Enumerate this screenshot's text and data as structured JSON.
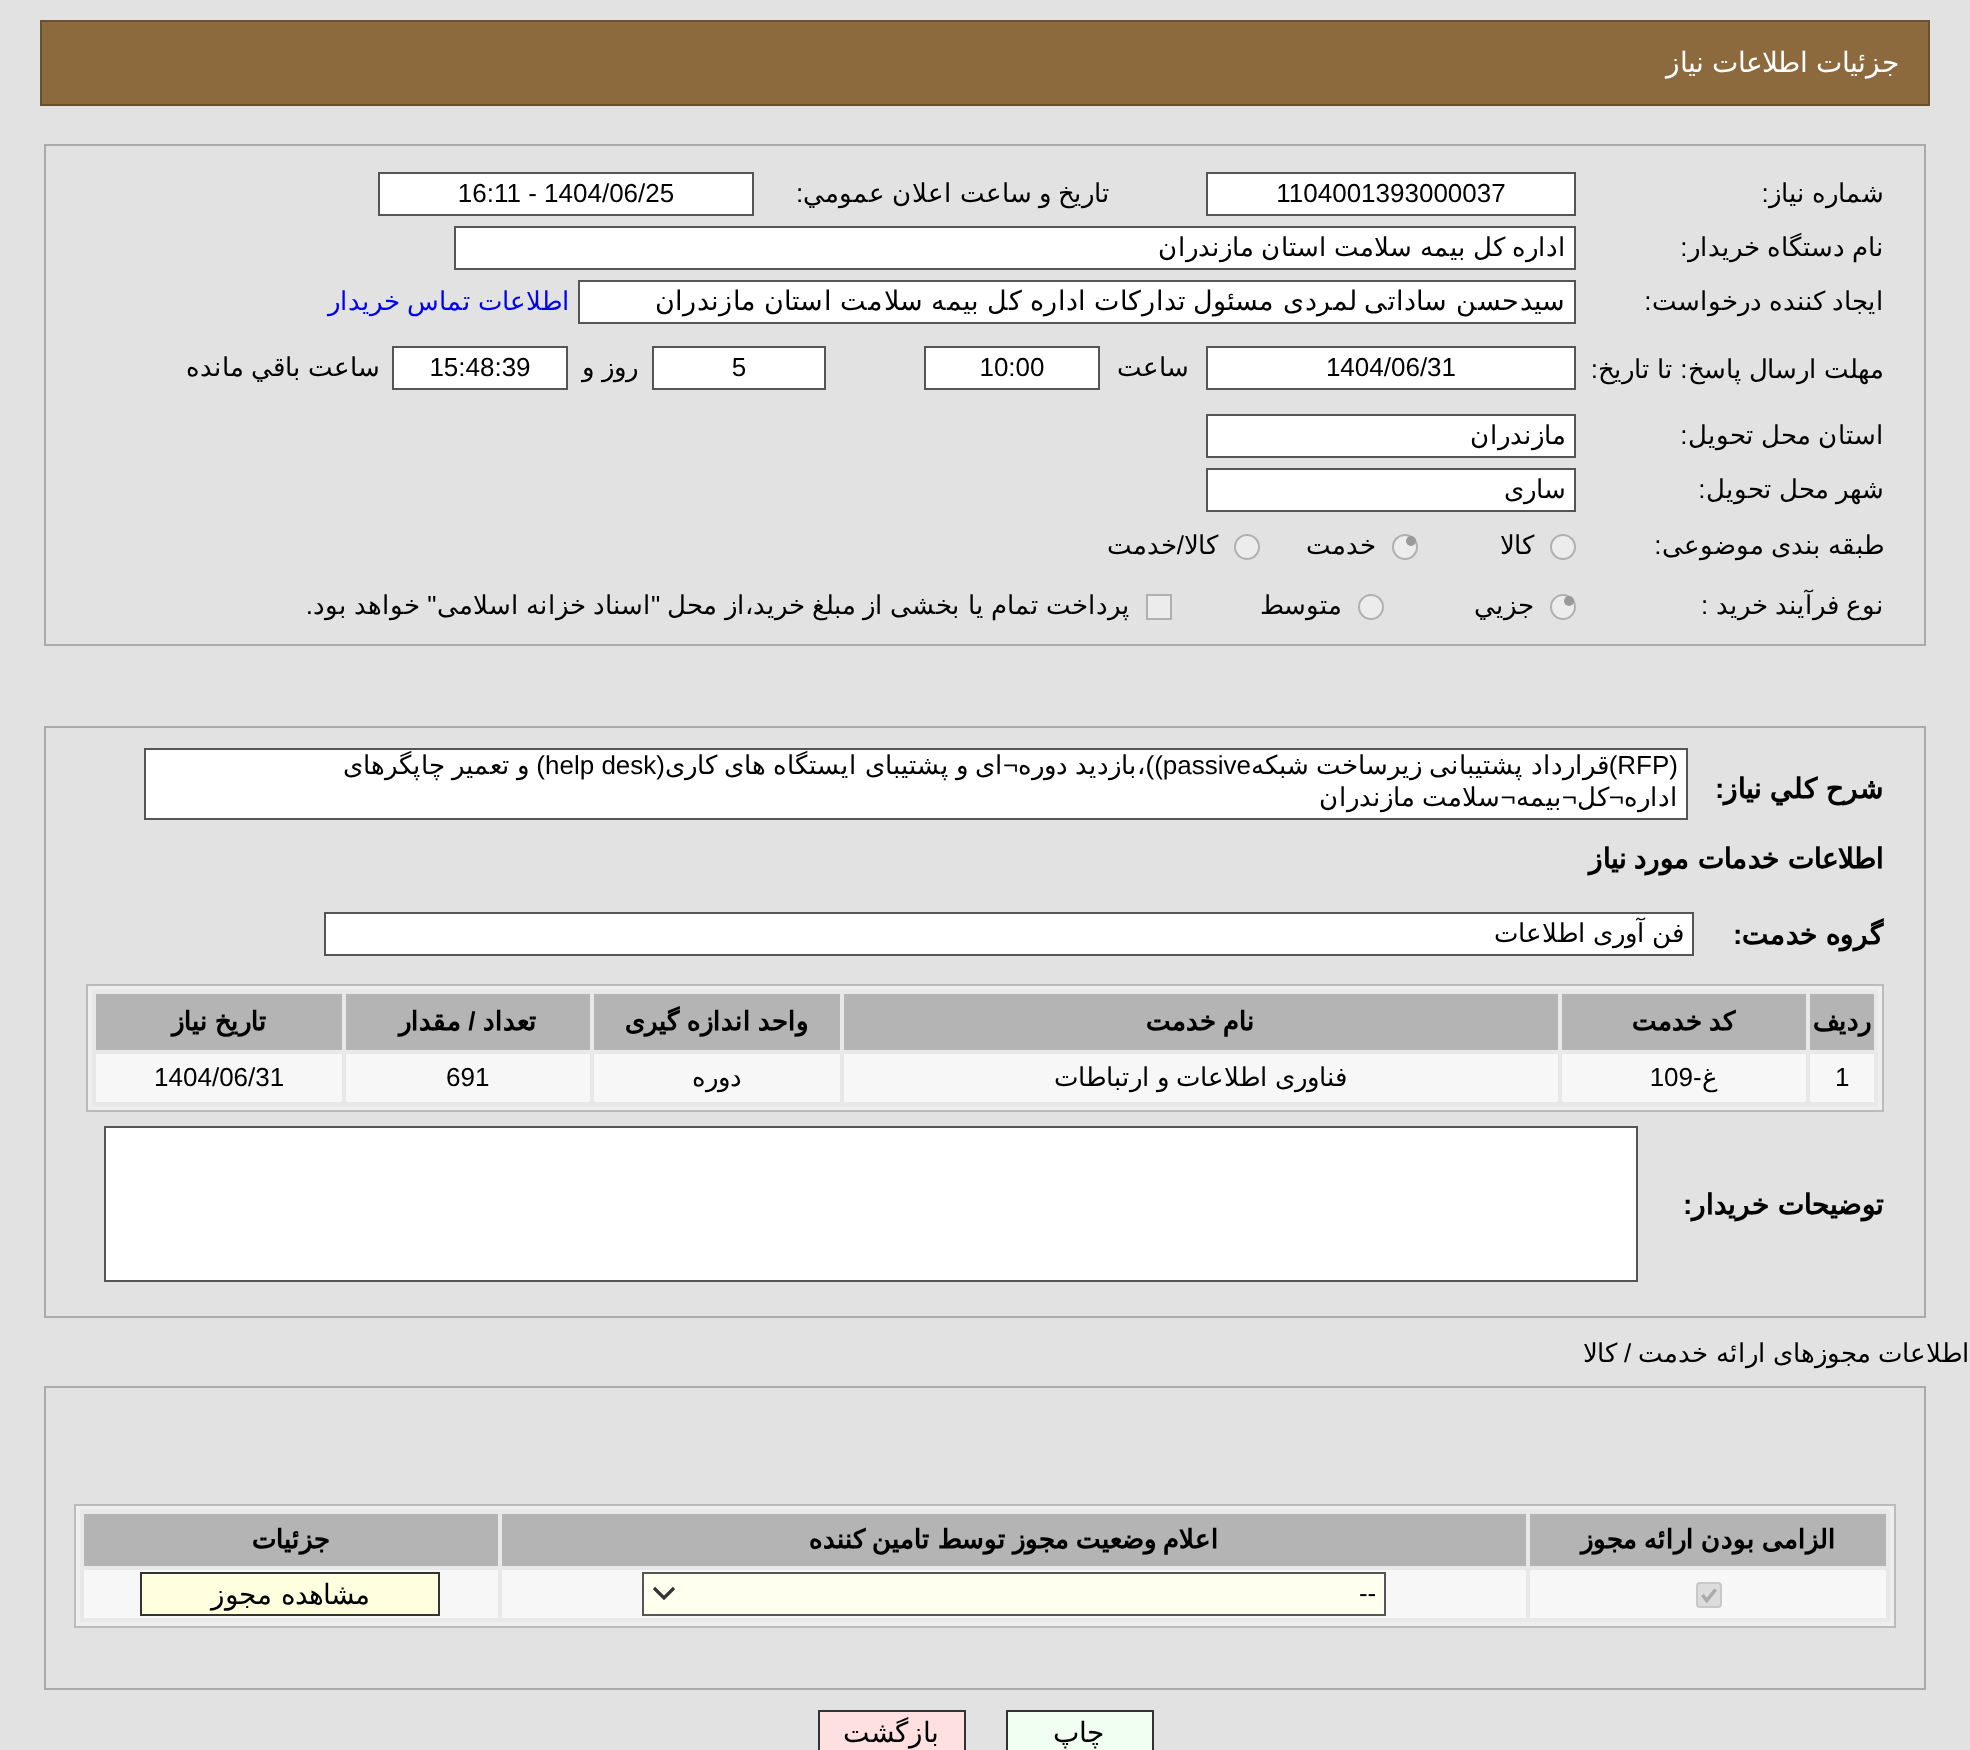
{
  "header": {
    "title": "جزئیات اطلاعات نیاز"
  },
  "details": {
    "need_number": {
      "label": "شماره نیاز:",
      "value": "1104001393000037"
    },
    "announce": {
      "label": "تاریخ و ساعت اعلان عمومي:",
      "value": "1404/06/25 - 16:11"
    },
    "buyer": {
      "label": "نام دستگاه خریدار:",
      "value": "اداره کل بیمه سلامت استان مازندران"
    },
    "creator": {
      "label": "ایجاد کننده درخواست:",
      "value": "سیدحسن ساداتی لمردی مسئول تدارکات اداره کل بیمه سلامت استان مازندران",
      "link": "اطلاعات تماس خریدار"
    },
    "deadline": {
      "label": "مهلت ارسال پاسخ: تا تاریخ:",
      "date": "1404/06/31",
      "time_label": "ساعت",
      "time": "10:00",
      "days": "5",
      "days_label": "روز و",
      "remaining": "15:48:39",
      "remaining_label": "ساعت باقي مانده"
    },
    "province": {
      "label": "استان محل تحویل:",
      "value": "مازندران"
    },
    "city": {
      "label": "شهر محل تحویل:",
      "value": "ساری"
    },
    "category": {
      "label": "طبقه بندی موضوعی:",
      "options": [
        {
          "label": "کالا",
          "selected": false
        },
        {
          "label": "خدمت",
          "selected": true
        },
        {
          "label": "کالا/خدمت",
          "selected": false
        }
      ]
    },
    "process": {
      "label": "نوع فرآیند خرید :",
      "options": [
        {
          "label": "جزيي",
          "selected": true
        },
        {
          "label": "متوسط",
          "selected": false
        }
      ],
      "payment": {
        "label": "پرداخت تمام یا بخشی از مبلغ خرید،از محل \"اسناد خزانه اسلامی\" خواهد بود.",
        "checked": false
      }
    }
  },
  "description": {
    "label": "شرح کلي نیاز:",
    "value": "(RFP)قرارداد پشتیبانی زیرساخت شبکهpassive))،بازدید دوره¬ای و پشتیبای ایستگاه های کاری(help desk) و تعمیر چاپگرهای اداره¬کل¬بیمه¬سلامت مازندران"
  },
  "services": {
    "heading": "اطلاعات خدمات مورد نیاز",
    "group_label": "گروه خدمت:",
    "group": "فن آوری اطلاعات",
    "table": {
      "columns": [
        "ردیف",
        "کد خدمت",
        "نام خدمت",
        "واحد اندازه گیری",
        "تعداد / مقدار",
        "تاریخ نیاز"
      ],
      "rows": [
        [
          "1",
          "غ-109",
          "فناوری اطلاعات و ارتباطات",
          "دوره",
          "691",
          "1404/06/31"
        ]
      ]
    },
    "notes_label": "توضیحات خریدار:"
  },
  "permits": {
    "heading": "اطلاعات مجوزهای ارائه خدمت / کالا",
    "columns": [
      "الزامی بودن ارائه مجوز",
      "اعلام وضعیت مجوز توسط تامین کننده",
      "جزئیات"
    ],
    "rows": [
      {
        "required": true,
        "status": "--",
        "action": "مشاهده مجوز"
      }
    ]
  },
  "buttons": [
    {
      "label": "چاپ",
      "kind": "print"
    },
    {
      "label": "بازگشت",
      "kind": "back"
    }
  ]
}
